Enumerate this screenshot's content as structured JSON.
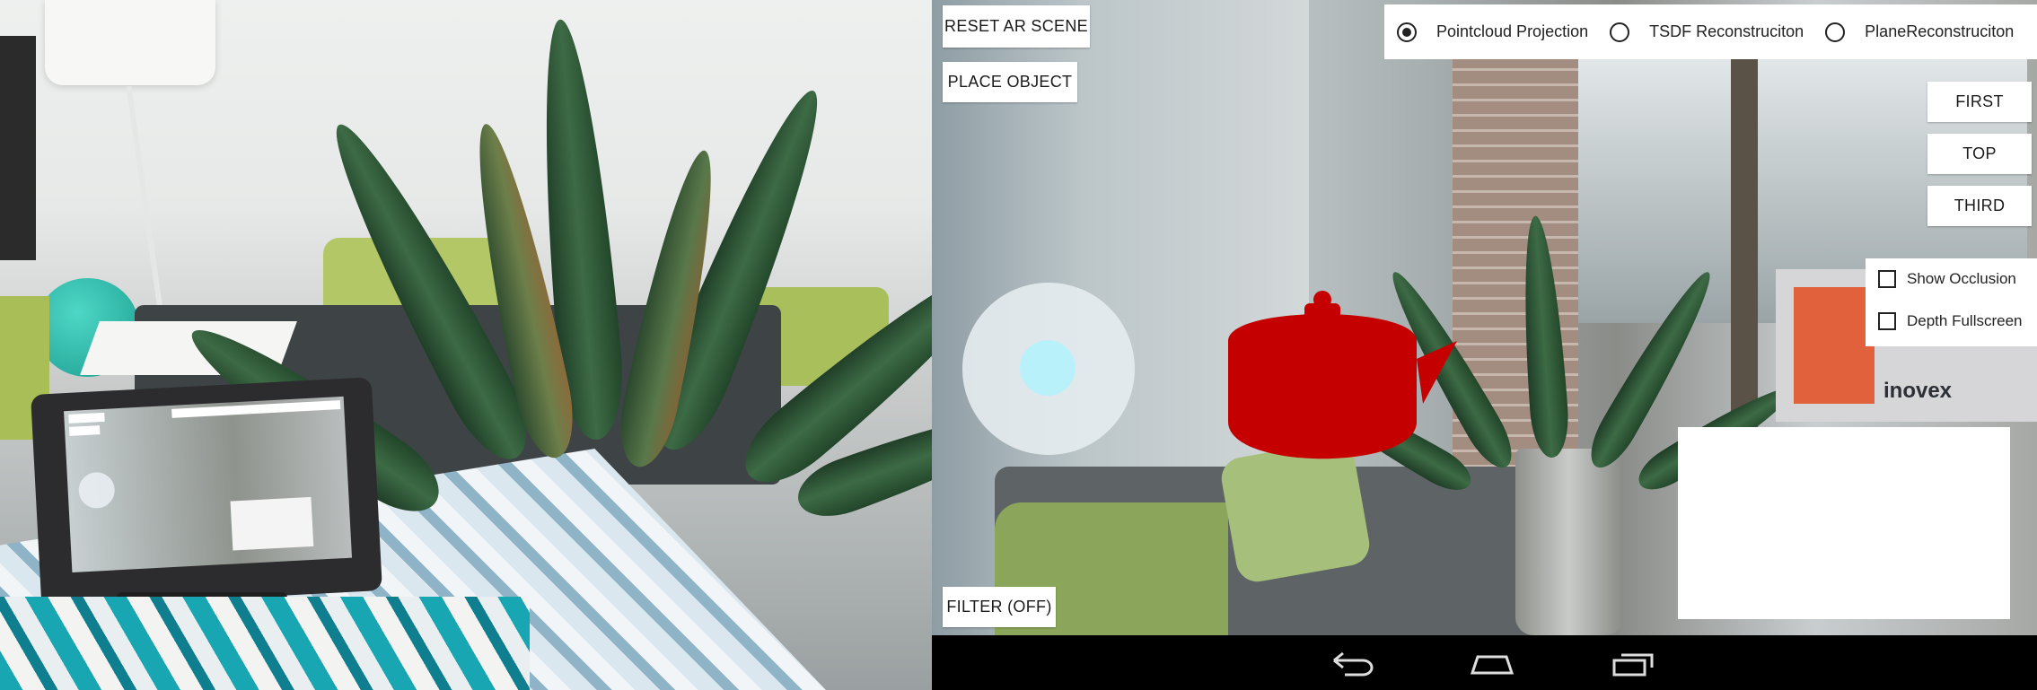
{
  "photo": {
    "tablet_screen_caption": "photo of tablet running the AR app next to a plant"
  },
  "toolbar": {
    "reset_label": "RESET AR SCENE",
    "place_label": "PLACE OBJECT",
    "filter_label": "FILTER (OFF)"
  },
  "reconstruction_modes": {
    "options": [
      {
        "label": "Pointcloud Projection",
        "selected": true
      },
      {
        "label": "TSDF Reconstruciton",
        "selected": false
      },
      {
        "label": "PlaneReconstruciton",
        "selected": false
      }
    ]
  },
  "camera_views": {
    "first": "FIRST",
    "top": "TOP",
    "third": "THIRD"
  },
  "options": {
    "show_occlusion": {
      "label": "Show Occlusion",
      "checked": false
    },
    "depth_fullscreen": {
      "label": "Depth Fullscreen",
      "checked": false
    }
  },
  "scene": {
    "object_color": "#c40000",
    "watermark_text": "inovex"
  },
  "colors": {
    "joystick_knob": "#b9f1fb",
    "navbar": "#000000"
  }
}
